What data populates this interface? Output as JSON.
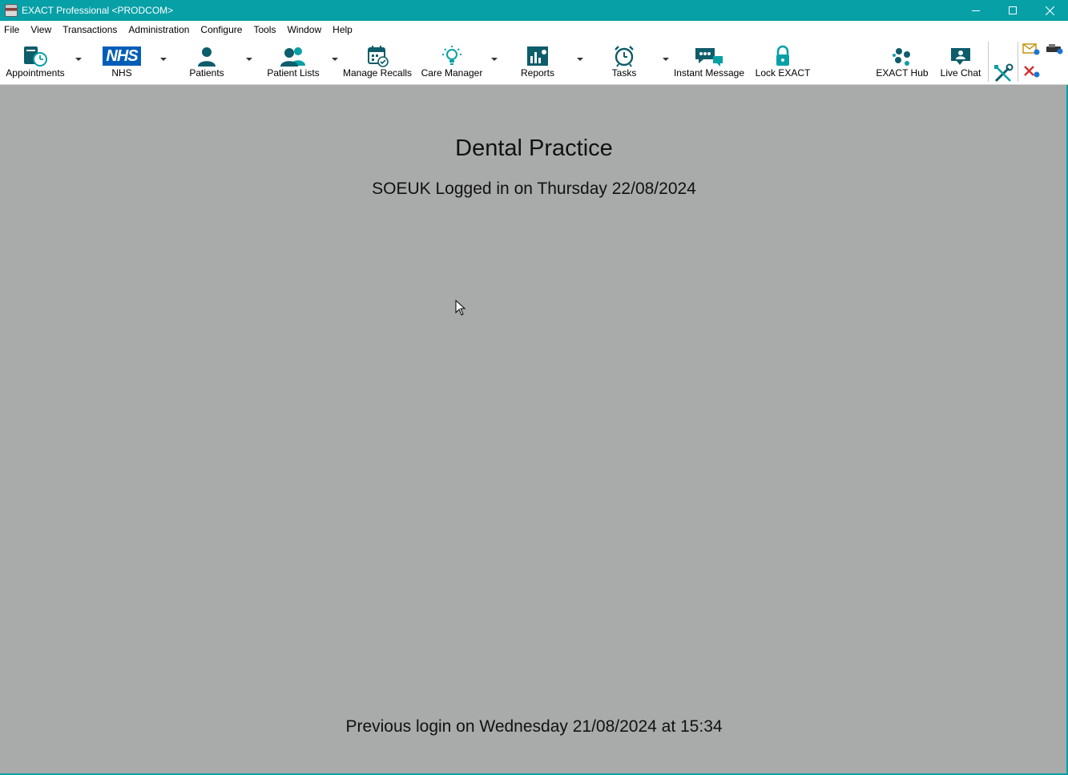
{
  "window": {
    "title": "EXACT Professional <PRODCOM>",
    "accent": "#07a0a7"
  },
  "menubar": {
    "items": [
      "File",
      "View",
      "Transactions",
      "Administration",
      "Configure",
      "Tools",
      "Window",
      "Help"
    ]
  },
  "toolbar": {
    "appointments": "Appointments",
    "nhs": "NHS",
    "nhs_logo": "NHS",
    "patients": "Patients",
    "patient_lists": "Patient Lists",
    "manage_recalls": "Manage Recalls",
    "care_manager": "Care Manager",
    "reports": "Reports",
    "tasks": "Tasks",
    "instant_message": "Instant Message",
    "lock_exact": "Lock EXACT",
    "exact_hub": "EXACT Hub",
    "live_chat": "Live Chat",
    "icon_color": "#0e5d6a"
  },
  "main": {
    "practice_name": "Dental Practice",
    "logged_in": "SOEUK Logged in on Thursday 22/08/2024",
    "previous_login": "Previous login on Wednesday 21/08/2024 at 15:34",
    "background": "#a9aaaa"
  }
}
